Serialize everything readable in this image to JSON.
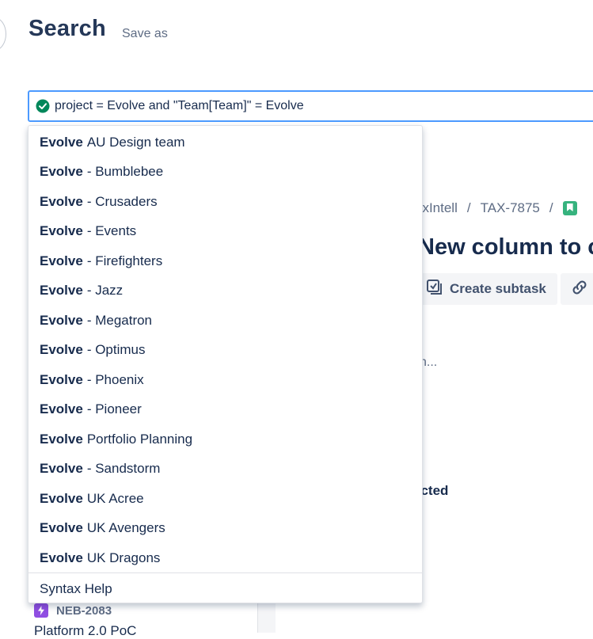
{
  "header": {
    "title": "Search",
    "save_as_label": "Save as"
  },
  "search": {
    "query": "project = Evolve and \"Team[Team]\" = Evolve",
    "status_icon": "check-circle-icon",
    "status_color": "#00875a"
  },
  "suggestions": {
    "items": [
      {
        "bold": "Evolve",
        "rest": "AU Design team"
      },
      {
        "bold": "Evolve",
        "rest": "- Bumblebee"
      },
      {
        "bold": "Evolve",
        "rest": "- Crusaders"
      },
      {
        "bold": "Evolve",
        "rest": "- Events"
      },
      {
        "bold": "Evolve",
        "rest": "- Firefighters"
      },
      {
        "bold": "Evolve",
        "rest": "- Jazz"
      },
      {
        "bold": "Evolve",
        "rest": "- Megatron"
      },
      {
        "bold": "Evolve",
        "rest": "- Optimus"
      },
      {
        "bold": "Evolve",
        "rest": "- Phoenix"
      },
      {
        "bold": "Evolve",
        "rest": "- Pioneer"
      },
      {
        "bold": "Evolve",
        "rest": "Portfolio Planning"
      },
      {
        "bold": "Evolve",
        "rest": "- Sandstorm"
      },
      {
        "bold": "Evolve",
        "rest": "UK Acree"
      },
      {
        "bold": "Evolve",
        "rest": "UK Avengers"
      },
      {
        "bold": "Evolve",
        "rest": "UK Dragons"
      }
    ],
    "syntax_help_label": "Syntax Help"
  },
  "issue_view": {
    "breadcrumb_project": "axIntell",
    "breadcrumb_sep": "/",
    "breadcrumb_key": "TAX-7875",
    "title": "New column to c",
    "create_subtask_label": "Create subtask",
    "partial_text_1": "n...",
    "partial_text_2": "ected"
  },
  "issue_list": {
    "visible_item_key": "NEB-2083",
    "visible_item_summary": "Platform 2.0 PoC"
  },
  "colors": {
    "accent_focus": "#4c9aff",
    "story_green": "#36b37e",
    "epic_purple": "#904ee2"
  }
}
